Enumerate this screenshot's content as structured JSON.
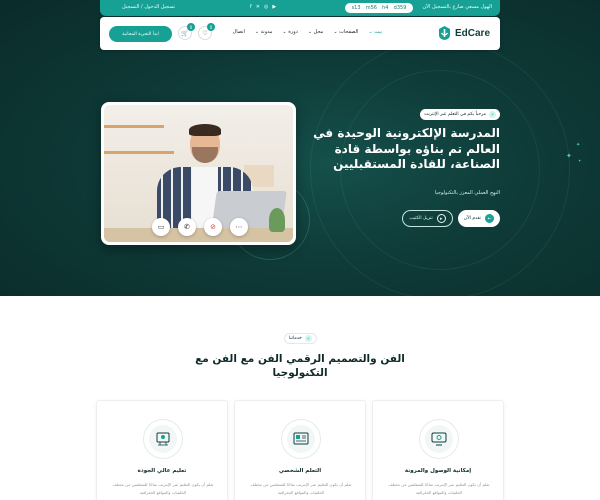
{
  "topbar": {
    "promo": "الهول مسعي صارع بالتسجيل الآن",
    "countdown": [
      "d359",
      "h4",
      "m56",
      "s13"
    ],
    "socials": [
      "f-icon",
      "x-icon",
      "instagram-icon",
      "youtube-icon"
    ],
    "login": "تسجيل الدخول / التسجيل"
  },
  "navbar": {
    "logo": "EdCare",
    "menu": [
      "بيت",
      "الصفحات",
      "محل",
      "دورة",
      "مدونة",
      "اتصال"
    ],
    "cart_count": "0",
    "wishlist_count": "0",
    "cta": "ابدأ التجربة المجانية"
  },
  "hero": {
    "tag": "مرحباً بكم في التعلم عبر الإنترنت",
    "title": "المدرسة الإلكترونية الوحيدة في العالم تم بناؤه بواسطة قادة الصناعة، للقادة المستقبليين",
    "subtitle": "النهج العملي المعزز بالتكنولوجيا",
    "primary_btn": "تقدم الآن",
    "secondary_btn": "تنزيل الكتيب"
  },
  "services": {
    "tag": "خدماتنا",
    "title": "الفن والتصميم الرقمي الفن مع الفن مع التكنولوجيا",
    "cards": [
      {
        "title": "إمكانية الوصول والمرونة",
        "text": "تعلم أن يكون التعليم عبر الإنترنت متاحًا للمتعلمين من مختلف الخلفيات والمواقع الجغرافية"
      },
      {
        "title": "التعلم الشخصي",
        "text": "تعلم أن يكون التعليم عبر الإنترنت متاحًا للمتعلمين من مختلف الخلفيات والمواقع الجغرافية"
      },
      {
        "title": "تعليم عالي الجودة",
        "text": "تعلم أن يكون التعليم عبر الإنترنت متاحًا للمتعلمين من مختلف الخلفيات والمواقع الجغرافية"
      }
    ]
  },
  "colors": {
    "brand": "#17a094",
    "hero_bg": "#0e3a37",
    "dark_text": "#0e2a29"
  }
}
